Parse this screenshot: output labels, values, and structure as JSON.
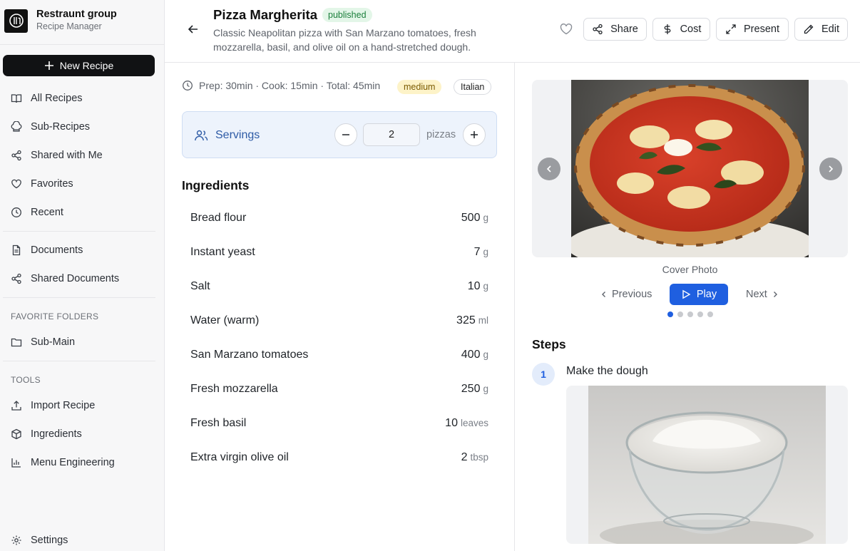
{
  "brand": {
    "name": "Restraunt group",
    "subtitle": "Recipe Manager"
  },
  "sidebar": {
    "new_recipe": "New Recipe",
    "items": [
      {
        "label": "All Recipes",
        "icon": "book-icon"
      },
      {
        "label": "Sub-Recipes",
        "icon": "chef-hat-icon"
      },
      {
        "label": "Shared with Me",
        "icon": "share-icon"
      },
      {
        "label": "Favorites",
        "icon": "heart-icon"
      },
      {
        "label": "Recent",
        "icon": "clock-icon"
      }
    ],
    "docs": [
      {
        "label": "Documents",
        "icon": "document-icon"
      },
      {
        "label": "Shared Documents",
        "icon": "share-icon"
      }
    ],
    "favorite_folders_label": "FAVORITE FOLDERS",
    "folders": [
      {
        "label": "Sub-Main",
        "icon": "folder-icon"
      }
    ],
    "tools_label": "TOOLS",
    "tools": [
      {
        "label": "Import Recipe",
        "icon": "upload-icon"
      },
      {
        "label": "Ingredients",
        "icon": "package-icon"
      },
      {
        "label": "Menu Engineering",
        "icon": "bar-chart-icon"
      }
    ],
    "settings": "Settings"
  },
  "header": {
    "title": "Pizza Margherita",
    "status": "published",
    "description": "Classic Neapolitan pizza with San Marzano tomatoes, fresh mozzarella, basil, and olive oil on a hand-stretched dough.",
    "buttons": {
      "share": "Share",
      "cost": "Cost",
      "present": "Present",
      "edit": "Edit"
    }
  },
  "meta": {
    "times": "Prep: 30min · Cook: 15min · Total: 45min",
    "difficulty": "medium",
    "cuisine": "Italian"
  },
  "servings": {
    "label": "Servings",
    "value": "2",
    "unit": "pizzas"
  },
  "ingredients": {
    "heading": "Ingredients",
    "items": [
      {
        "name": "Bread flour",
        "qty": "500",
        "unit": "g"
      },
      {
        "name": "Instant yeast",
        "qty": "7",
        "unit": "g"
      },
      {
        "name": "Salt",
        "qty": "10",
        "unit": "g"
      },
      {
        "name": "Water (warm)",
        "qty": "325",
        "unit": "ml"
      },
      {
        "name": "San Marzano tomatoes",
        "qty": "400",
        "unit": "g"
      },
      {
        "name": "Fresh mozzarella",
        "qty": "250",
        "unit": "g"
      },
      {
        "name": "Fresh basil",
        "qty": "10",
        "unit": "leaves"
      },
      {
        "name": "Extra virgin olive oil",
        "qty": "2",
        "unit": "tbsp"
      }
    ]
  },
  "gallery": {
    "caption": "Cover Photo",
    "previous": "Previous",
    "play": "Play",
    "next": "Next",
    "active_index": 0,
    "count": 5
  },
  "steps": {
    "heading": "Steps",
    "items": [
      {
        "num": "1",
        "title": "Make the dough"
      }
    ]
  },
  "colors": {
    "accent": "#1f5fe0",
    "published_bg": "#e3f6e8",
    "medium_bg": "#fdf3c8",
    "servings_bg": "#edf3fc"
  }
}
